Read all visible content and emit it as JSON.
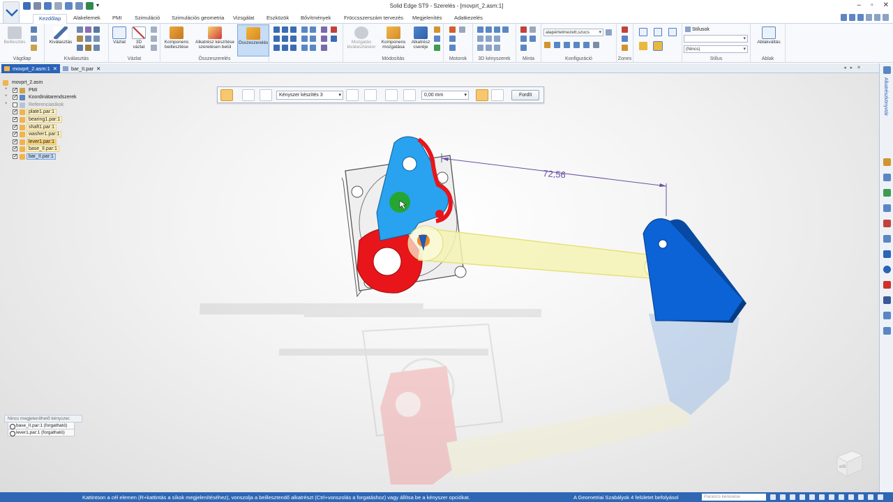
{
  "window": {
    "title": "Solid Edge ST9 - Szerelés - [movprt_2.asm:1]",
    "controls": [
      "–",
      "▫",
      "✕"
    ]
  },
  "ribbon_tabs": [
    "Kezdőlap",
    "Alakelemek",
    "PMI",
    "Szimuláció",
    "Szimulációs geometria",
    "Vizsgálat",
    "Eszközök",
    "Bővítmények",
    "Fröccsszerszám tervezés",
    "Megjelenítés",
    "Adatkezelés"
  ],
  "ribbon": {
    "groups": {
      "clipboard": "Vágólap",
      "select": "Kiválasztás",
      "sketch": "Vázlat",
      "assemble": "Összeszerelés",
      "modify": "Módosítás",
      "motors": "Motorok",
      "constraints3d": "3D kényszerek",
      "pattern": "Minta",
      "config": "Konfiguráció",
      "zones": "Zones",
      "style": "Stílus",
      "windows": "Ablak"
    },
    "buttons": {
      "paste": "Beillesztés",
      "select": "Kiválasztás",
      "sketch": "Vázlat",
      "sketch3d_1": "3D",
      "sketch3d_2": "vázlat",
      "place_comp_1": "Komponens",
      "place_comp_2": "beillesztése",
      "create_part_1": "Alkatrész készítése",
      "create_part_2": "szerelésen belül",
      "assemble": "Összeszerelés",
      "move_1": "Mozgatás",
      "move_2": "kiválasztáskor",
      "move_comp_1": "Komponens",
      "move_comp_2": "mozgatása",
      "replace_1": "Alkatrész",
      "replace_2": "cseréje",
      "switch_windows": "Ablakváltás"
    },
    "config_combo": "alapértelmezett,szucs",
    "style_label": "Stílusok",
    "style_combo": "(Nincs)"
  },
  "doc_tabs": [
    {
      "label": "movprt_2.asm:1",
      "close": "✕"
    },
    {
      "label": "bar_II.par",
      "close": "✕"
    }
  ],
  "doc_nav": "◂ ▸ ✕",
  "tree": {
    "root": "movprt_2.asm",
    "items": [
      {
        "label": "PMI",
        "checked": true
      },
      {
        "label": "Koordinátarendszerek",
        "checked": true
      },
      {
        "label": "Referenciasíkok",
        "checked": false
      },
      {
        "label": "plate1.par:1",
        "checked": true
      },
      {
        "label": "bearing1.par:1",
        "checked": true
      },
      {
        "label": "shaft1.par:1",
        "checked": true
      },
      {
        "label": "washer1.par:1",
        "checked": true
      },
      {
        "label": "lever1.par:1",
        "checked": true
      },
      {
        "label": "base_II.par:1",
        "checked": true
      },
      {
        "label": "bar_II.par:1",
        "checked": true
      }
    ]
  },
  "constraints_panel": {
    "header": "Nincs megjeleníthető kényszer.",
    "rows": [
      "base_II.par:1  (forgatható)",
      "lever1.par:1  (forgatható)"
    ]
  },
  "command_bar": {
    "relationship": "Kényszer készítés 3",
    "offset": "0,00 mm",
    "flip": "Fordít"
  },
  "dimension": "72,56",
  "viewcube": {
    "label": "elől"
  },
  "right_dock": {
    "label": "Alkatrészkönyvtár"
  },
  "status": {
    "prompt": "Kattintson a cél elemen (R+kattintás a síkok megjelenítéséhez), vonszolja a beillesztendő alkatrészt (Ctrl+vonszolás a forgatáshoz) vagy állítsa be a kényszer opciókat.",
    "rules": "A Geometriai Szabályok 4 felületet befolyásol",
    "search_placeholder": "Parancs keresése"
  },
  "colors": {
    "accent": "#2a63b7",
    "lever_red": "#e8151b",
    "lever_blue": "#29a3f0",
    "base_blue": "#0b63d6",
    "bar_yellow": "#f6f3b4"
  }
}
